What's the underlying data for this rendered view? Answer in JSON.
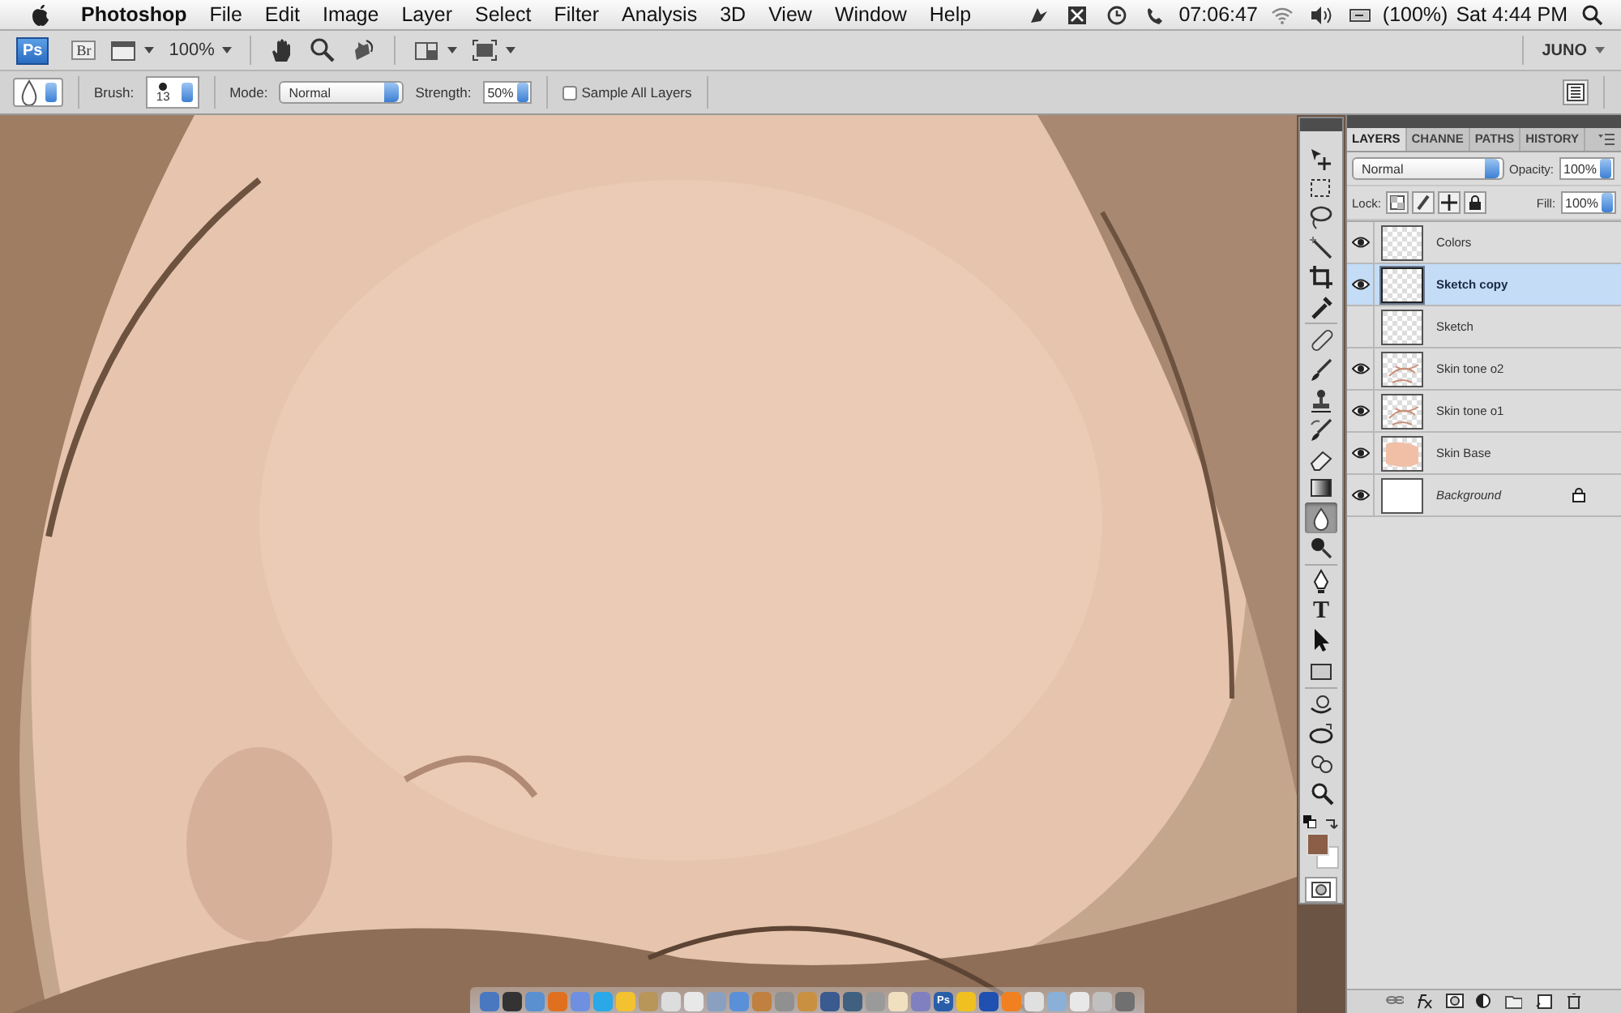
{
  "menu_bar": {
    "app": "Photoshop",
    "items": [
      "File",
      "Edit",
      "Image",
      "Layer",
      "Select",
      "Filter",
      "Analysis",
      "3D",
      "View",
      "Window",
      "Help"
    ],
    "status": [
      {
        "kind": "bird"
      },
      {
        "kind": "box"
      },
      {
        "kind": "clock"
      },
      {
        "kind": "phone",
        "label": "07:06:47"
      },
      {
        "kind": "wifi"
      },
      {
        "kind": "volume"
      },
      {
        "kind": "battery",
        "label": "(100%)"
      },
      {
        "kind": "text",
        "label": "Sat 4:44 PM"
      },
      {
        "kind": "search"
      }
    ]
  },
  "app_bar": {
    "ps_label": "Ps",
    "br_label": "Br",
    "zoom": "100%",
    "workspace": "JUNO"
  },
  "options_bar": {
    "brush_label": "Brush:",
    "brush_size": "13",
    "mode_label": "Mode:",
    "mode": "Normal",
    "strength_label": "Strength:",
    "strength": "50%",
    "sample_all": {
      "label": "Sample All Layers",
      "checked": false
    }
  },
  "tools": [
    {
      "kind": "move",
      "selected": false
    },
    {
      "kind": "marquee",
      "selected": false
    },
    {
      "kind": "lasso",
      "selected": false
    },
    {
      "kind": "wand",
      "selected": false
    },
    {
      "kind": "crop",
      "selected": false
    },
    {
      "kind": "eyedropper",
      "selected": false
    },
    {
      "kind": "sep"
    },
    {
      "kind": "bandage",
      "selected": false
    },
    {
      "kind": "brush",
      "selected": false
    },
    {
      "kind": "stamp",
      "selected": false
    },
    {
      "kind": "history",
      "selected": false
    },
    {
      "kind": "eraser",
      "selected": false
    },
    {
      "kind": "gradient",
      "selected": false
    },
    {
      "kind": "drop",
      "selected": true
    },
    {
      "kind": "dodge",
      "selected": false
    },
    {
      "kind": "sep"
    },
    {
      "kind": "pen",
      "selected": false
    },
    {
      "kind": "type",
      "label": "T",
      "selected": false
    },
    {
      "kind": "arrow",
      "selected": false
    },
    {
      "kind": "rect",
      "selected": false
    },
    {
      "kind": "sep"
    },
    {
      "kind": "rotate3d",
      "selected": false
    },
    {
      "kind": "orbit3d",
      "selected": false
    },
    {
      "kind": "pan3d",
      "selected": false
    },
    {
      "kind": "zoom",
      "selected": false
    }
  ],
  "layers_panel": {
    "tabs": [
      {
        "label": "LAYERS",
        "selected": true
      },
      {
        "label": "CHANNE",
        "selected": false
      },
      {
        "label": "PATHS",
        "selected": false
      },
      {
        "label": "HISTORY",
        "selected": false
      }
    ],
    "blend_mode": "Normal",
    "opacity_label": "Opacity:",
    "opacity": "100%",
    "lock_label": "Lock:",
    "fill_label": "Fill:",
    "fill": "100%",
    "layers": [
      {
        "name": "Colors",
        "visible": true,
        "selected": false,
        "kind": "transparent"
      },
      {
        "name": "Sketch copy",
        "visible": true,
        "selected": true,
        "kind": "transparent"
      },
      {
        "name": "Sketch",
        "visible": false,
        "selected": false,
        "kind": "transparent"
      },
      {
        "name": "Skin tone o2",
        "visible": true,
        "selected": false,
        "kind": "strokes"
      },
      {
        "name": "Skin tone o1",
        "visible": true,
        "selected": false,
        "kind": "strokes"
      },
      {
        "name": "Skin Base",
        "visible": true,
        "selected": false,
        "kind": "skin"
      },
      {
        "name": "Background",
        "visible": true,
        "selected": false,
        "kind": "white",
        "locked": true
      }
    ]
  },
  "dock": [
    {
      "color": "#4a78c0"
    },
    {
      "color": "#333333"
    },
    {
      "color": "#5a8fd0"
    },
    {
      "color": "#e07020"
    },
    {
      "color": "#6f8fe0"
    },
    {
      "color": "#2aa8e8"
    },
    {
      "color": "#f2c230"
    },
    {
      "color": "#b8965a"
    },
    {
      "color": "#dddddd"
    },
    {
      "color": "#e8e8e8"
    },
    {
      "color": "#8aa0c0"
    },
    {
      "color": "#5a90d8"
    },
    {
      "color": "#c08040"
    },
    {
      "color": "#909090"
    },
    {
      "color": "#c89040"
    },
    {
      "color": "#3a5a90"
    },
    {
      "color": "#406080"
    },
    {
      "color": "#9a9a9a"
    },
    {
      "color": "#f0e0c0"
    },
    {
      "color": "#8080c0"
    },
    {
      "color": "#2a5ea8",
      "label": "Ps"
    },
    {
      "color": "#f0c020"
    },
    {
      "color": "#2050b0"
    },
    {
      "color": "#f08020"
    },
    {
      "color": "#e0e0e0"
    },
    {
      "color": "#8ab0d8"
    },
    {
      "color": "#e8e8e8"
    },
    {
      "color": "#c0c0c0"
    },
    {
      "color": "#707070"
    }
  ]
}
